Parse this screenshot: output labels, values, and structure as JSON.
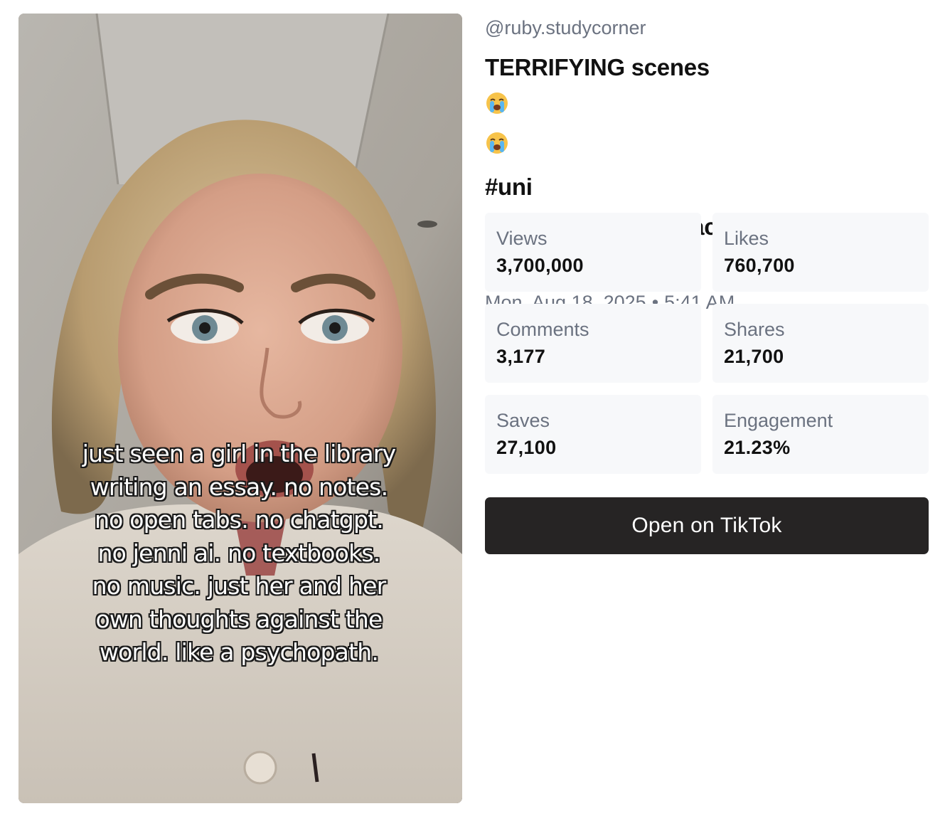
{
  "video": {
    "thumbnail_icon": "video-thumbnail-image",
    "caption_lines": [
      "just seen a girl in the library",
      "writing an essay. no notes.",
      "no open tabs. no chatgpt.",
      "no jenni ai. no textbooks.",
      "no music. just her and her",
      "own thoughts against the",
      "world. like a psychopath."
    ]
  },
  "post": {
    "handle": "@ruby.studycorner",
    "title_lines": [
      "TERRIFYING scenes",
      "#studytok #essayhack #unihack",
      "#essay"
    ],
    "title_emoji_icon": "loudly-crying-face-icon",
    "title_line1_suffix": "#uni",
    "date": "Mon, Aug 18, 2025",
    "separator": "•",
    "time": "5:41 AM"
  },
  "stats": [
    {
      "label": "Views",
      "value": "3,700,000"
    },
    {
      "label": "Likes",
      "value": "760,700"
    },
    {
      "label": "Comments",
      "value": "3,177"
    },
    {
      "label": "Shares",
      "value": "21,700"
    },
    {
      "label": "Saves",
      "value": "27,100"
    },
    {
      "label": "Engagement",
      "value": "21.23%"
    }
  ],
  "actions": {
    "open_label": "Open on TikTok"
  },
  "colors": {
    "button_bg": "#262424",
    "stat_bg": "#f7f8fa",
    "muted_text": "#6b7280"
  }
}
